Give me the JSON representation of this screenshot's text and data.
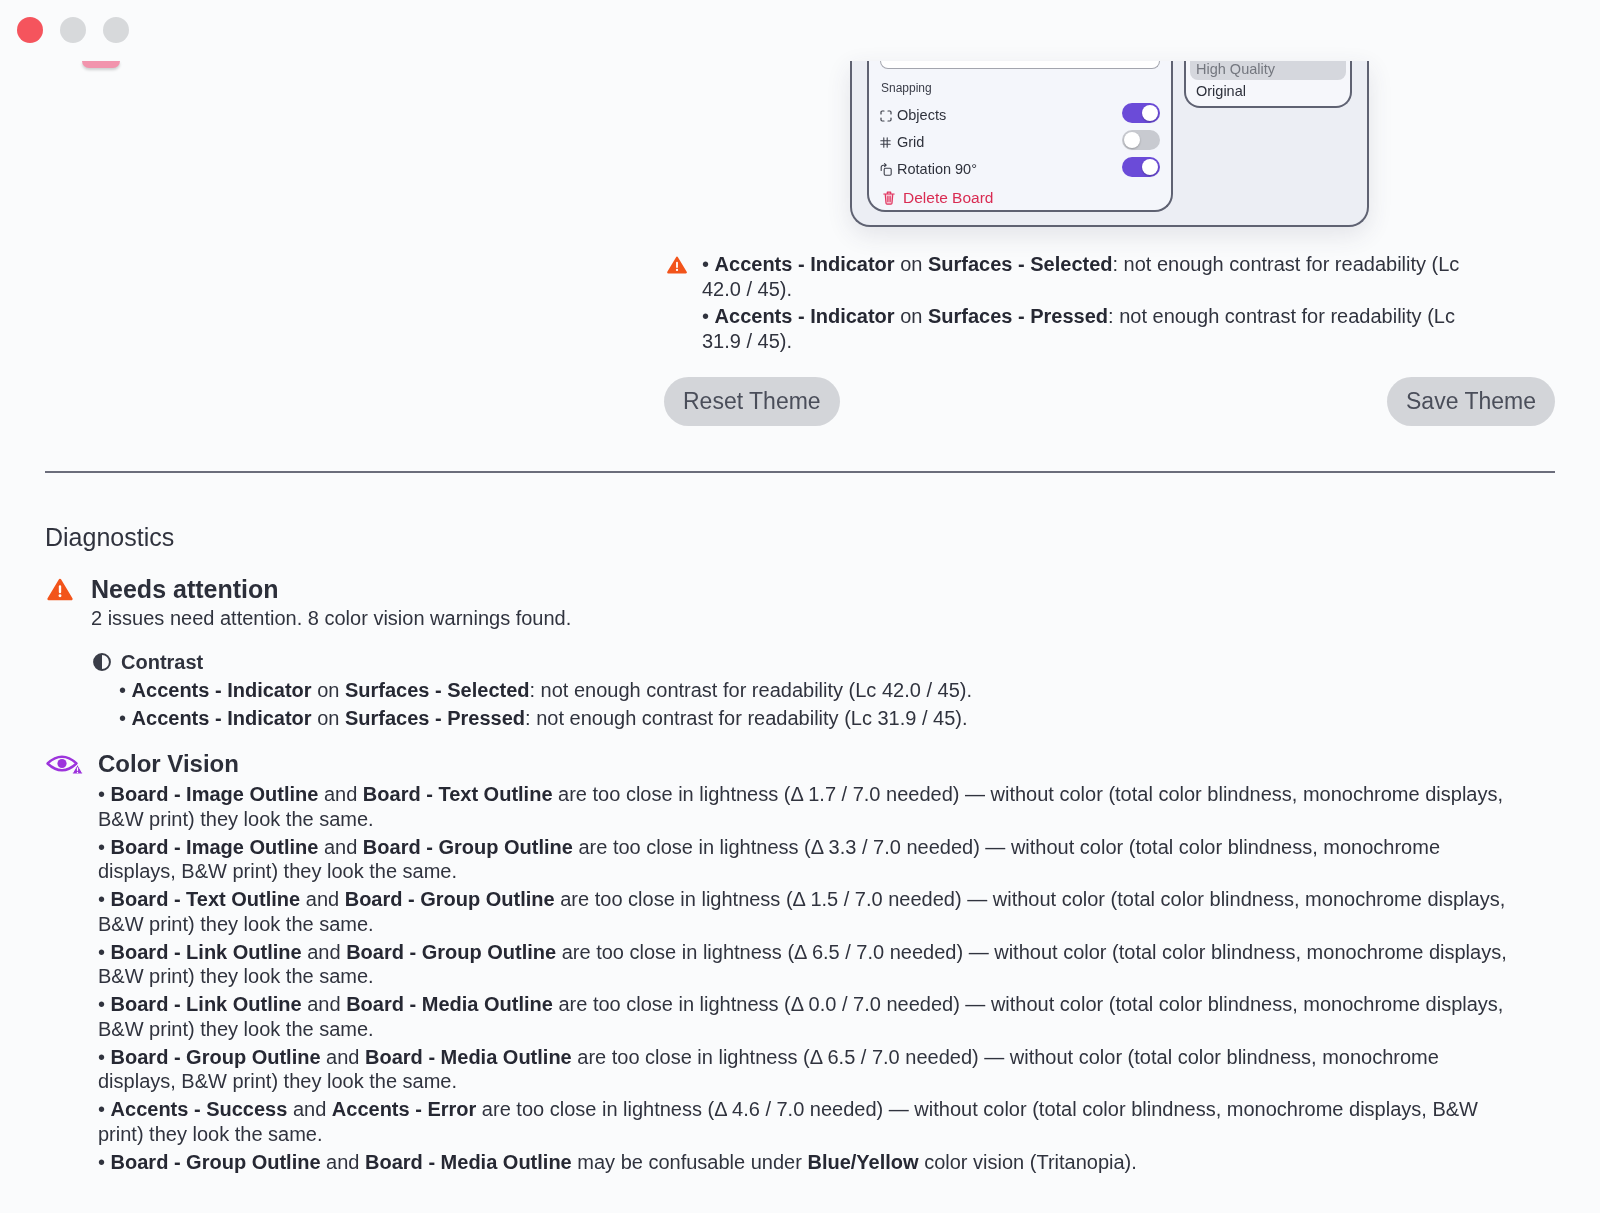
{
  "window_controls": [
    {
      "kind": "close",
      "disabled": false
    },
    {
      "kind": "minimize",
      "disabled": true
    },
    {
      "kind": "zoom",
      "disabled": true
    }
  ],
  "preview": {
    "snapping": {
      "heading": "Snapping",
      "options": [
        {
          "label": "Objects",
          "on": true
        },
        {
          "label": "Grid",
          "on": false
        },
        {
          "label": "Rotation 90°",
          "on": true
        }
      ]
    },
    "delete_button": "Delete Board",
    "quality_menu": [
      {
        "label": "High Quality",
        "selected": true
      },
      {
        "label": "Original",
        "selected": false
      }
    ]
  },
  "preview_warnings": [
    "• **Accents - Indicator** on **Surfaces - Selected**: not enough contrast for readability (Lc 42.0 / 45).",
    "• **Accents - Indicator** on **Surfaces - Pressed**: not enough contrast for readability (Lc 31.9 / 45)."
  ],
  "reset_button": "Reset Theme",
  "save_button": "Save Theme",
  "diagnostics": {
    "title": "Diagnostics",
    "status": {
      "kind": "warning",
      "title": "Needs attention",
      "summary": "2 issues need attention. 8 color vision warnings found."
    },
    "sections": [
      {
        "kind": "contrast",
        "title": "Contrast",
        "items": [
          "• **Accents - Indicator** on **Surfaces - Selected**: not enough contrast for readability (Lc 42.0 / 45).",
          "• **Accents - Indicator** on **Surfaces - Pressed**: not enough contrast for readability (Lc 31.9 / 45)."
        ]
      },
      {
        "kind": "color_vision",
        "title": "Color Vision",
        "items": [
          "• **Board - Image Outline** and **Board - Text Outline** are too close in lightness (Δ 1.7 / 7.0 needed) — without color (total color blindness, monochrome displays, B&W print) they look the same.",
          "• **Board - Image Outline** and **Board - Group Outline** are too close in lightness (Δ 3.3 / 7.0 needed) — without color (total color blindness, monochrome displays, B&W print) they look the same.",
          "• **Board - Text Outline** and **Board - Group Outline** are too close in lightness (Δ 1.5 / 7.0 needed) — without color (total color blindness, monochrome displays, B&W print) they look the same.",
          "• **Board - Link Outline** and **Board - Group Outline** are too close in lightness (Δ 6.5 / 7.0 needed) — without color (total color blindness, monochrome displays, B&W print) they look the same.",
          "• **Board - Link Outline** and **Board - Media Outline** are too close in lightness (Δ 0.0 / 7.0 needed) — without color (total color blindness, monochrome displays, B&W print) they look the same.",
          "• **Board - Group Outline** and **Board - Media Outline** are too close in lightness (Δ 6.5 / 7.0 needed) — without color (total color blindness, monochrome displays, B&W print) they look the same.",
          "• **Accents - Success** and **Accents - Error** are too close in lightness (Δ 4.6 / 7.0 needed) — without color (total color blindness, monochrome displays, B&W print) they look the same.",
          "• **Board - Group Outline** and **Board - Media Outline** may be confusable under **Blue/Yellow** color vision (Tritanopia)."
        ]
      }
    ]
  }
}
